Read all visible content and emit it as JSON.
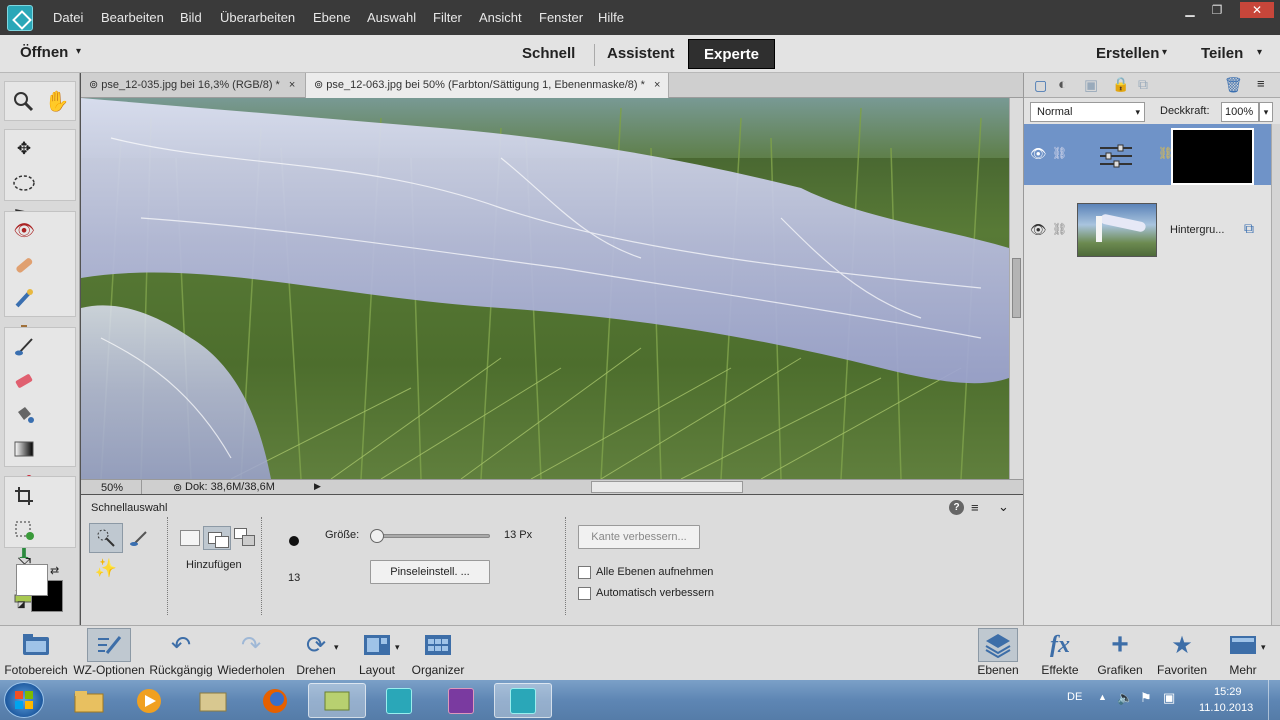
{
  "menu": [
    "Datei",
    "Bearbeiten",
    "Bild",
    "Überarbeiten",
    "Ebene",
    "Auswahl",
    "Filter",
    "Ansicht",
    "Fenster",
    "Hilfe"
  ],
  "window_controls": {
    "minimize": "▁",
    "restore": "❐",
    "close": "✕"
  },
  "modebar": {
    "open_label": "Öffnen",
    "modes": [
      "Schnell",
      "Assistent",
      "Experte"
    ],
    "active_mode": "Experte",
    "create_label": "Erstellen",
    "share_label": "Teilen"
  },
  "tabs": [
    {
      "label": "pse_12-035.jpg bei 16,3% (RGB/8) *",
      "active": false
    },
    {
      "label": "pse_12-063.jpg bei 50% (Farbton/Sättigung 1, Ebenenmaske/8) *",
      "active": true
    }
  ],
  "tab_close": "×",
  "tab_icon": "⊚",
  "status": {
    "zoom": "50%",
    "doc": "Dok: 38,6M/38,6M"
  },
  "options": {
    "tool_name": "Schnellauswahl",
    "mode_label": "Hinzufügen",
    "brush_size_value": "13",
    "size_label": "Größe:",
    "size_value": "13 Px",
    "size_fraction": 0.05,
    "brush_settings": "Pinseleinstell. ...",
    "refine_edge": "Kante verbessern...",
    "check_all_layers": "Alle Ebenen aufnehmen",
    "check_auto_enhance": "Automatisch verbessern",
    "help": "?"
  },
  "layers": {
    "blend_mode": "Normal",
    "opacity_label": "Deckkraft:",
    "opacity_value": "100%",
    "items": [
      {
        "name": "",
        "type": "adjustment",
        "selected": true
      },
      {
        "name": "Hintergru...",
        "type": "image",
        "selected": false
      }
    ]
  },
  "bottom": {
    "left": [
      {
        "label": "Fotobereich",
        "icon": "photo-bin-icon"
      },
      {
        "label": "WZ-Optionen",
        "icon": "tool-options-icon"
      },
      {
        "label": "Rückgängig",
        "icon": "undo-icon"
      },
      {
        "label": "Wiederholen",
        "icon": "redo-icon"
      },
      {
        "label": "Drehen",
        "icon": "rotate-icon"
      },
      {
        "label": "Layout",
        "icon": "layout-icon"
      },
      {
        "label": "Organizer",
        "icon": "organizer-icon"
      }
    ],
    "right": [
      {
        "label": "Ebenen",
        "icon": "layers-icon"
      },
      {
        "label": "Effekte",
        "icon": "fx-icon"
      },
      {
        "label": "Grafiken",
        "icon": "plus-icon"
      },
      {
        "label": "Favoriten",
        "icon": "star-icon"
      },
      {
        "label": "Mehr",
        "icon": "more-icon"
      }
    ]
  },
  "taskbar": {
    "lang": "DE",
    "time": "15:29",
    "date": "11.10.2013"
  },
  "colors": {
    "accent": "#2aa7b8",
    "selection": "#6f93c8",
    "menubar": "#3a3a3a"
  }
}
